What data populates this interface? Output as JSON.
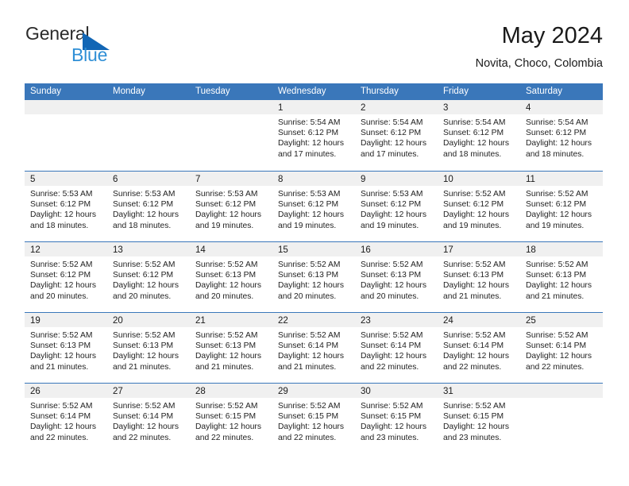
{
  "brand": {
    "word1": "General",
    "word2": "Blue",
    "accent_color": "#1266b5",
    "blue_text_color": "#2f8fd6"
  },
  "header": {
    "title": "May 2024",
    "subtitle": "Novita, Choco, Colombia"
  },
  "calendar": {
    "header_bg": "#3a77ba",
    "daynum_band_bg": "#f0f0f0",
    "weekday_names": [
      "Sunday",
      "Monday",
      "Tuesday",
      "Wednesday",
      "Thursday",
      "Friday",
      "Saturday"
    ],
    "weeks": [
      [
        {
          "day": "",
          "lines": []
        },
        {
          "day": "",
          "lines": []
        },
        {
          "day": "",
          "lines": []
        },
        {
          "day": "1",
          "lines": [
            "Sunrise: 5:54 AM",
            "Sunset: 6:12 PM",
            "Daylight: 12 hours",
            "and 17 minutes."
          ]
        },
        {
          "day": "2",
          "lines": [
            "Sunrise: 5:54 AM",
            "Sunset: 6:12 PM",
            "Daylight: 12 hours",
            "and 17 minutes."
          ]
        },
        {
          "day": "3",
          "lines": [
            "Sunrise: 5:54 AM",
            "Sunset: 6:12 PM",
            "Daylight: 12 hours",
            "and 18 minutes."
          ]
        },
        {
          "day": "4",
          "lines": [
            "Sunrise: 5:54 AM",
            "Sunset: 6:12 PM",
            "Daylight: 12 hours",
            "and 18 minutes."
          ]
        }
      ],
      [
        {
          "day": "5",
          "lines": [
            "Sunrise: 5:53 AM",
            "Sunset: 6:12 PM",
            "Daylight: 12 hours",
            "and 18 minutes."
          ]
        },
        {
          "day": "6",
          "lines": [
            "Sunrise: 5:53 AM",
            "Sunset: 6:12 PM",
            "Daylight: 12 hours",
            "and 18 minutes."
          ]
        },
        {
          "day": "7",
          "lines": [
            "Sunrise: 5:53 AM",
            "Sunset: 6:12 PM",
            "Daylight: 12 hours",
            "and 19 minutes."
          ]
        },
        {
          "day": "8",
          "lines": [
            "Sunrise: 5:53 AM",
            "Sunset: 6:12 PM",
            "Daylight: 12 hours",
            "and 19 minutes."
          ]
        },
        {
          "day": "9",
          "lines": [
            "Sunrise: 5:53 AM",
            "Sunset: 6:12 PM",
            "Daylight: 12 hours",
            "and 19 minutes."
          ]
        },
        {
          "day": "10",
          "lines": [
            "Sunrise: 5:52 AM",
            "Sunset: 6:12 PM",
            "Daylight: 12 hours",
            "and 19 minutes."
          ]
        },
        {
          "day": "11",
          "lines": [
            "Sunrise: 5:52 AM",
            "Sunset: 6:12 PM",
            "Daylight: 12 hours",
            "and 19 minutes."
          ]
        }
      ],
      [
        {
          "day": "12",
          "lines": [
            "Sunrise: 5:52 AM",
            "Sunset: 6:12 PM",
            "Daylight: 12 hours",
            "and 20 minutes."
          ]
        },
        {
          "day": "13",
          "lines": [
            "Sunrise: 5:52 AM",
            "Sunset: 6:12 PM",
            "Daylight: 12 hours",
            "and 20 minutes."
          ]
        },
        {
          "day": "14",
          "lines": [
            "Sunrise: 5:52 AM",
            "Sunset: 6:13 PM",
            "Daylight: 12 hours",
            "and 20 minutes."
          ]
        },
        {
          "day": "15",
          "lines": [
            "Sunrise: 5:52 AM",
            "Sunset: 6:13 PM",
            "Daylight: 12 hours",
            "and 20 minutes."
          ]
        },
        {
          "day": "16",
          "lines": [
            "Sunrise: 5:52 AM",
            "Sunset: 6:13 PM",
            "Daylight: 12 hours",
            "and 20 minutes."
          ]
        },
        {
          "day": "17",
          "lines": [
            "Sunrise: 5:52 AM",
            "Sunset: 6:13 PM",
            "Daylight: 12 hours",
            "and 21 minutes."
          ]
        },
        {
          "day": "18",
          "lines": [
            "Sunrise: 5:52 AM",
            "Sunset: 6:13 PM",
            "Daylight: 12 hours",
            "and 21 minutes."
          ]
        }
      ],
      [
        {
          "day": "19",
          "lines": [
            "Sunrise: 5:52 AM",
            "Sunset: 6:13 PM",
            "Daylight: 12 hours",
            "and 21 minutes."
          ]
        },
        {
          "day": "20",
          "lines": [
            "Sunrise: 5:52 AM",
            "Sunset: 6:13 PM",
            "Daylight: 12 hours",
            "and 21 minutes."
          ]
        },
        {
          "day": "21",
          "lines": [
            "Sunrise: 5:52 AM",
            "Sunset: 6:13 PM",
            "Daylight: 12 hours",
            "and 21 minutes."
          ]
        },
        {
          "day": "22",
          "lines": [
            "Sunrise: 5:52 AM",
            "Sunset: 6:14 PM",
            "Daylight: 12 hours",
            "and 21 minutes."
          ]
        },
        {
          "day": "23",
          "lines": [
            "Sunrise: 5:52 AM",
            "Sunset: 6:14 PM",
            "Daylight: 12 hours",
            "and 22 minutes."
          ]
        },
        {
          "day": "24",
          "lines": [
            "Sunrise: 5:52 AM",
            "Sunset: 6:14 PM",
            "Daylight: 12 hours",
            "and 22 minutes."
          ]
        },
        {
          "day": "25",
          "lines": [
            "Sunrise: 5:52 AM",
            "Sunset: 6:14 PM",
            "Daylight: 12 hours",
            "and 22 minutes."
          ]
        }
      ],
      [
        {
          "day": "26",
          "lines": [
            "Sunrise: 5:52 AM",
            "Sunset: 6:14 PM",
            "Daylight: 12 hours",
            "and 22 minutes."
          ]
        },
        {
          "day": "27",
          "lines": [
            "Sunrise: 5:52 AM",
            "Sunset: 6:14 PM",
            "Daylight: 12 hours",
            "and 22 minutes."
          ]
        },
        {
          "day": "28",
          "lines": [
            "Sunrise: 5:52 AM",
            "Sunset: 6:15 PM",
            "Daylight: 12 hours",
            "and 22 minutes."
          ]
        },
        {
          "day": "29",
          "lines": [
            "Sunrise: 5:52 AM",
            "Sunset: 6:15 PM",
            "Daylight: 12 hours",
            "and 22 minutes."
          ]
        },
        {
          "day": "30",
          "lines": [
            "Sunrise: 5:52 AM",
            "Sunset: 6:15 PM",
            "Daylight: 12 hours",
            "and 23 minutes."
          ]
        },
        {
          "day": "31",
          "lines": [
            "Sunrise: 5:52 AM",
            "Sunset: 6:15 PM",
            "Daylight: 12 hours",
            "and 23 minutes."
          ]
        },
        {
          "day": "",
          "lines": []
        }
      ]
    ]
  }
}
